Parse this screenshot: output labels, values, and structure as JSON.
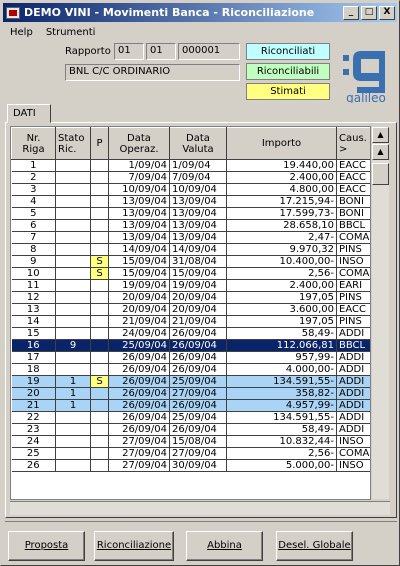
{
  "window": {
    "title": "DEMO VINI - Movimenti Banca - Riconciliazione",
    "min_glyph": "_",
    "max_glyph": "□",
    "close_glyph": "X"
  },
  "menu": [
    "Help",
    "Strumenti"
  ],
  "header": {
    "rapporto_label": "Rapporto",
    "rapporto_1": "01",
    "rapporto_2": "01",
    "rapporto_3": "000001",
    "conto": "BNL C/C ORDINARIO"
  },
  "legend": {
    "riconciliati": {
      "label": "Riconciliati",
      "color": "#c0ffff"
    },
    "riconciliabili": {
      "label": "Riconciliabili",
      "color": "#c0ffc0"
    },
    "stimati": {
      "label": "Stimati",
      "color": "#ffff80"
    }
  },
  "logo": {
    "text": "galileo",
    "color": "#3a6fb0"
  },
  "tab": {
    "label": "DATI"
  },
  "columns": [
    "Nr.\nRiga",
    "Stato\nRic.",
    "P",
    "Data\nOperaz.",
    "Data\nValuta",
    "Importo",
    "Caus.\n>"
  ],
  "rows": [
    {
      "n": "1",
      "stato": "",
      "p": "",
      "op": "1/09/04",
      "val": "1/09/04",
      "imp": "19.440,00",
      "caus": "EACC"
    },
    {
      "n": "2",
      "stato": "",
      "p": "",
      "op": "7/09/04",
      "val": "7/09/04",
      "imp": "2.400,00",
      "caus": "EACC"
    },
    {
      "n": "3",
      "stato": "",
      "p": "",
      "op": "10/09/04",
      "val": "10/09/04",
      "imp": "4.800,00",
      "caus": "EACC"
    },
    {
      "n": "4",
      "stato": "",
      "p": "",
      "op": "13/09/04",
      "val": "13/09/04",
      "imp": "17.215,94-",
      "caus": "BONI"
    },
    {
      "n": "5",
      "stato": "",
      "p": "",
      "op": "13/09/04",
      "val": "13/09/04",
      "imp": "17.599,73-",
      "caus": "BONI"
    },
    {
      "n": "6",
      "stato": "",
      "p": "",
      "op": "13/09/04",
      "val": "13/09/04",
      "imp": "28.658,10",
      "caus": "BBCL"
    },
    {
      "n": "7",
      "stato": "",
      "p": "",
      "op": "13/09/04",
      "val": "13/09/04",
      "imp": "2,47-",
      "caus": "COMA"
    },
    {
      "n": "8",
      "stato": "",
      "p": "",
      "op": "14/09/04",
      "val": "14/09/04",
      "imp": "9.970,32",
      "caus": "PINS"
    },
    {
      "n": "9",
      "stato": "",
      "p": "S",
      "op": "15/09/04",
      "val": "31/08/04",
      "imp": "10.400,00-",
      "caus": "INSO"
    },
    {
      "n": "10",
      "stato": "",
      "p": "S",
      "op": "15/09/04",
      "val": "15/09/04",
      "imp": "2,56-",
      "caus": "COMA"
    },
    {
      "n": "11",
      "stato": "",
      "p": "",
      "op": "19/09/04",
      "val": "19/09/04",
      "imp": "2.400,00",
      "caus": "EARI"
    },
    {
      "n": "12",
      "stato": "",
      "p": "",
      "op": "20/09/04",
      "val": "20/09/04",
      "imp": "197,05",
      "caus": "PINS"
    },
    {
      "n": "13",
      "stato": "",
      "p": "",
      "op": "20/09/04",
      "val": "20/09/04",
      "imp": "3.600,00",
      "caus": "EACC"
    },
    {
      "n": "14",
      "stato": "",
      "p": "",
      "op": "21/09/04",
      "val": "21/09/04",
      "imp": "197,05",
      "caus": "PINS"
    },
    {
      "n": "15",
      "stato": "",
      "p": "",
      "op": "24/09/04",
      "val": "26/09/04",
      "imp": "58,49-",
      "caus": "ADDI"
    },
    {
      "n": "16",
      "stato": "9",
      "p": "",
      "op": "25/09/04",
      "val": "26/09/04",
      "imp": "112.066,81",
      "caus": "BBCL"
    },
    {
      "n": "17",
      "stato": "",
      "p": "",
      "op": "26/09/04",
      "val": "26/09/04",
      "imp": "957,99-",
      "caus": "ADDI"
    },
    {
      "n": "18",
      "stato": "",
      "p": "",
      "op": "26/09/04",
      "val": "26/09/04",
      "imp": "4.000,00-",
      "caus": "ADDI"
    },
    {
      "n": "19",
      "stato": "1",
      "p": "S",
      "op": "26/09/04",
      "val": "25/09/04",
      "imp": "134.591,55-",
      "caus": "ADDI"
    },
    {
      "n": "20",
      "stato": "1",
      "p": "",
      "op": "26/09/04",
      "val": "27/09/04",
      "imp": "358,82-",
      "caus": "ADDI"
    },
    {
      "n": "21",
      "stato": "1",
      "p": "",
      "op": "26/09/04",
      "val": "26/09/04",
      "imp": "4.957,99-",
      "caus": "ADDI"
    },
    {
      "n": "22",
      "stato": "",
      "p": "",
      "op": "26/09/04",
      "val": "25/09/04",
      "imp": "134.591,55-",
      "caus": "ADDI"
    },
    {
      "n": "23",
      "stato": "",
      "p": "",
      "op": "26/09/04",
      "val": "26/09/04",
      "imp": "58,49-",
      "caus": "ADDI"
    },
    {
      "n": "24",
      "stato": "",
      "p": "",
      "op": "27/09/04",
      "val": "15/08/04",
      "imp": "10.832,44-",
      "caus": "INSO"
    },
    {
      "n": "25",
      "stato": "",
      "p": "",
      "op": "27/09/04",
      "val": "27/09/04",
      "imp": "2,56-",
      "caus": "COMA"
    },
    {
      "n": "26",
      "stato": "",
      "p": "",
      "op": "27/09/04",
      "val": "30/09/04",
      "imp": "5.000,00-",
      "caus": "INSO"
    }
  ],
  "selected_row": "16",
  "riconciliati_rows": [
    "19",
    "20",
    "21"
  ],
  "buttons": {
    "proposta": "Proposta",
    "riconciliazione": "Riconciliazione",
    "abbina": "Abbina",
    "desel": "Desel. Globale"
  }
}
